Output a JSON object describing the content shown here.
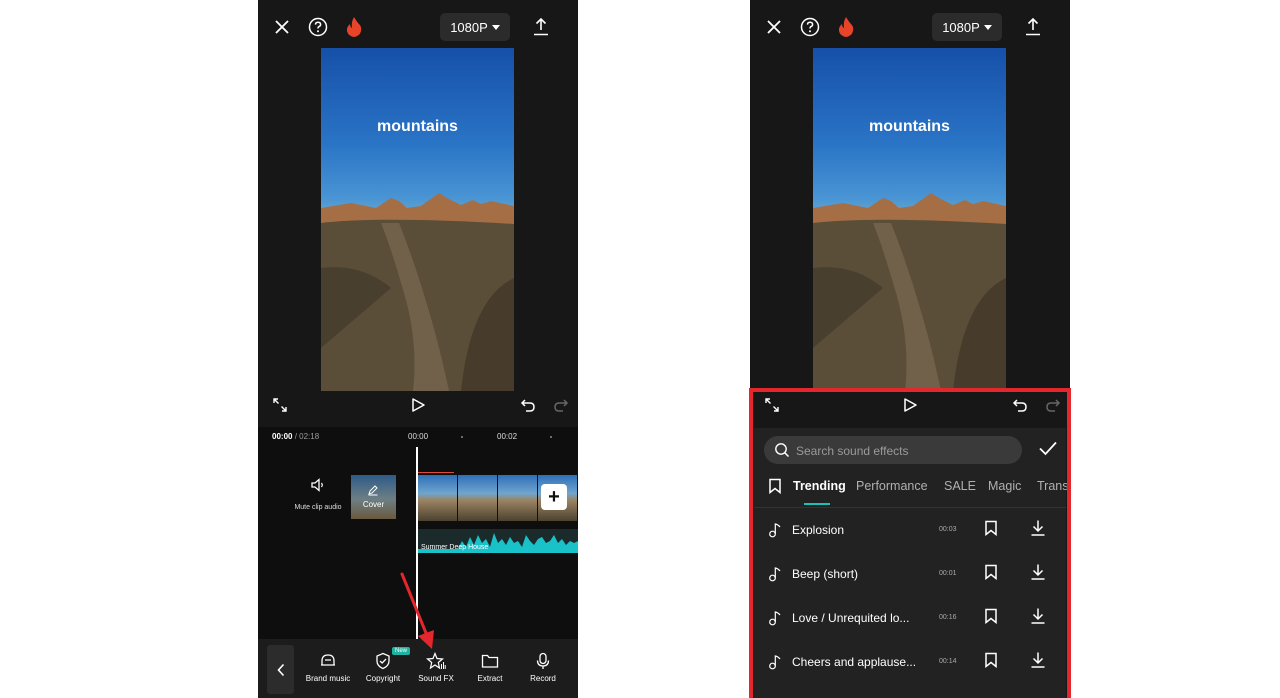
{
  "left_screen": {
    "top_bar": {
      "resolution": "1080P"
    },
    "preview": {
      "overlay_text": "mountains"
    },
    "timeline": {
      "current_time": "00:00",
      "total_time": "/ 02:18",
      "ticks": [
        "00:00",
        "00:02"
      ],
      "mute_label": "Mute clip audio",
      "cover_label": "Cover",
      "audio_track_label": "Summer Deep House"
    },
    "toolbar": {
      "items": [
        {
          "label": "Brand music",
          "icon": "brand-music-icon"
        },
        {
          "label": "Copyright",
          "icon": "shield-check-icon"
        },
        {
          "label": "Sound FX",
          "icon": "star-sound-icon"
        },
        {
          "label": "Extract",
          "icon": "folder-icon"
        },
        {
          "label": "Record",
          "icon": "microphone-icon"
        }
      ],
      "new_badge": "New"
    }
  },
  "right_screen": {
    "top_bar": {
      "resolution": "1080P"
    },
    "preview": {
      "overlay_text": "mountains"
    },
    "sound_effects": {
      "search_placeholder": "Search sound effects",
      "tabs": [
        "Trending",
        "Performance",
        "SALE",
        "Magic",
        "Trans"
      ],
      "active_tab": "Trending",
      "items": [
        {
          "title": "Explosion",
          "duration": "00:03"
        },
        {
          "title": "Beep (short)",
          "duration": "00:01"
        },
        {
          "title": "Love / Unrequited lo...",
          "duration": "00:16"
        },
        {
          "title": "Cheers and applause...",
          "duration": "00:14"
        }
      ]
    }
  },
  "colors": {
    "highlight_frame": "#e3272d",
    "accent": "#19c2b5",
    "arrow": "#e3272d",
    "flame": "#e8442a"
  }
}
